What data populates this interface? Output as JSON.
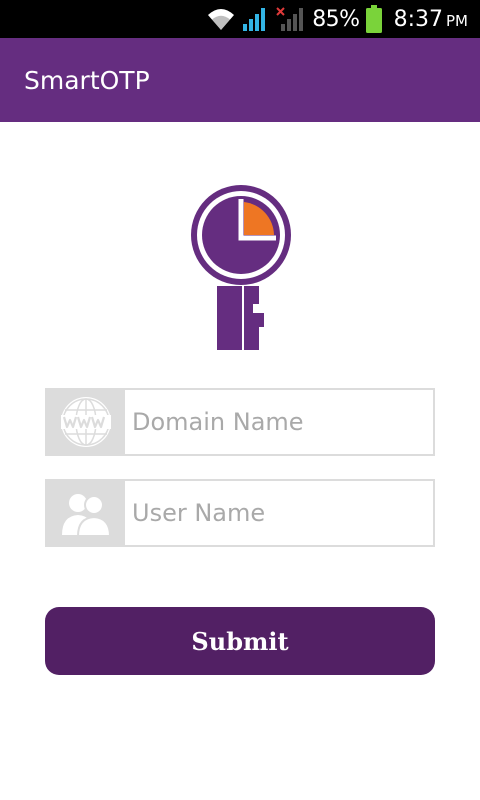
{
  "status_bar": {
    "battery_percent": "85%",
    "time": "8:37",
    "ampm": "PM"
  },
  "app_bar": {
    "title": "SmartOTP"
  },
  "form": {
    "domain_placeholder": "Domain Name",
    "user_placeholder": "User Name",
    "submit_label": "Submit"
  },
  "colors": {
    "brand_purple": "#652d80",
    "button_purple": "#522064",
    "accent_orange": "#ee7623"
  },
  "icons": {
    "domain": "www-globe-icon",
    "user": "users-icon",
    "logo": "clock-key-logo"
  }
}
